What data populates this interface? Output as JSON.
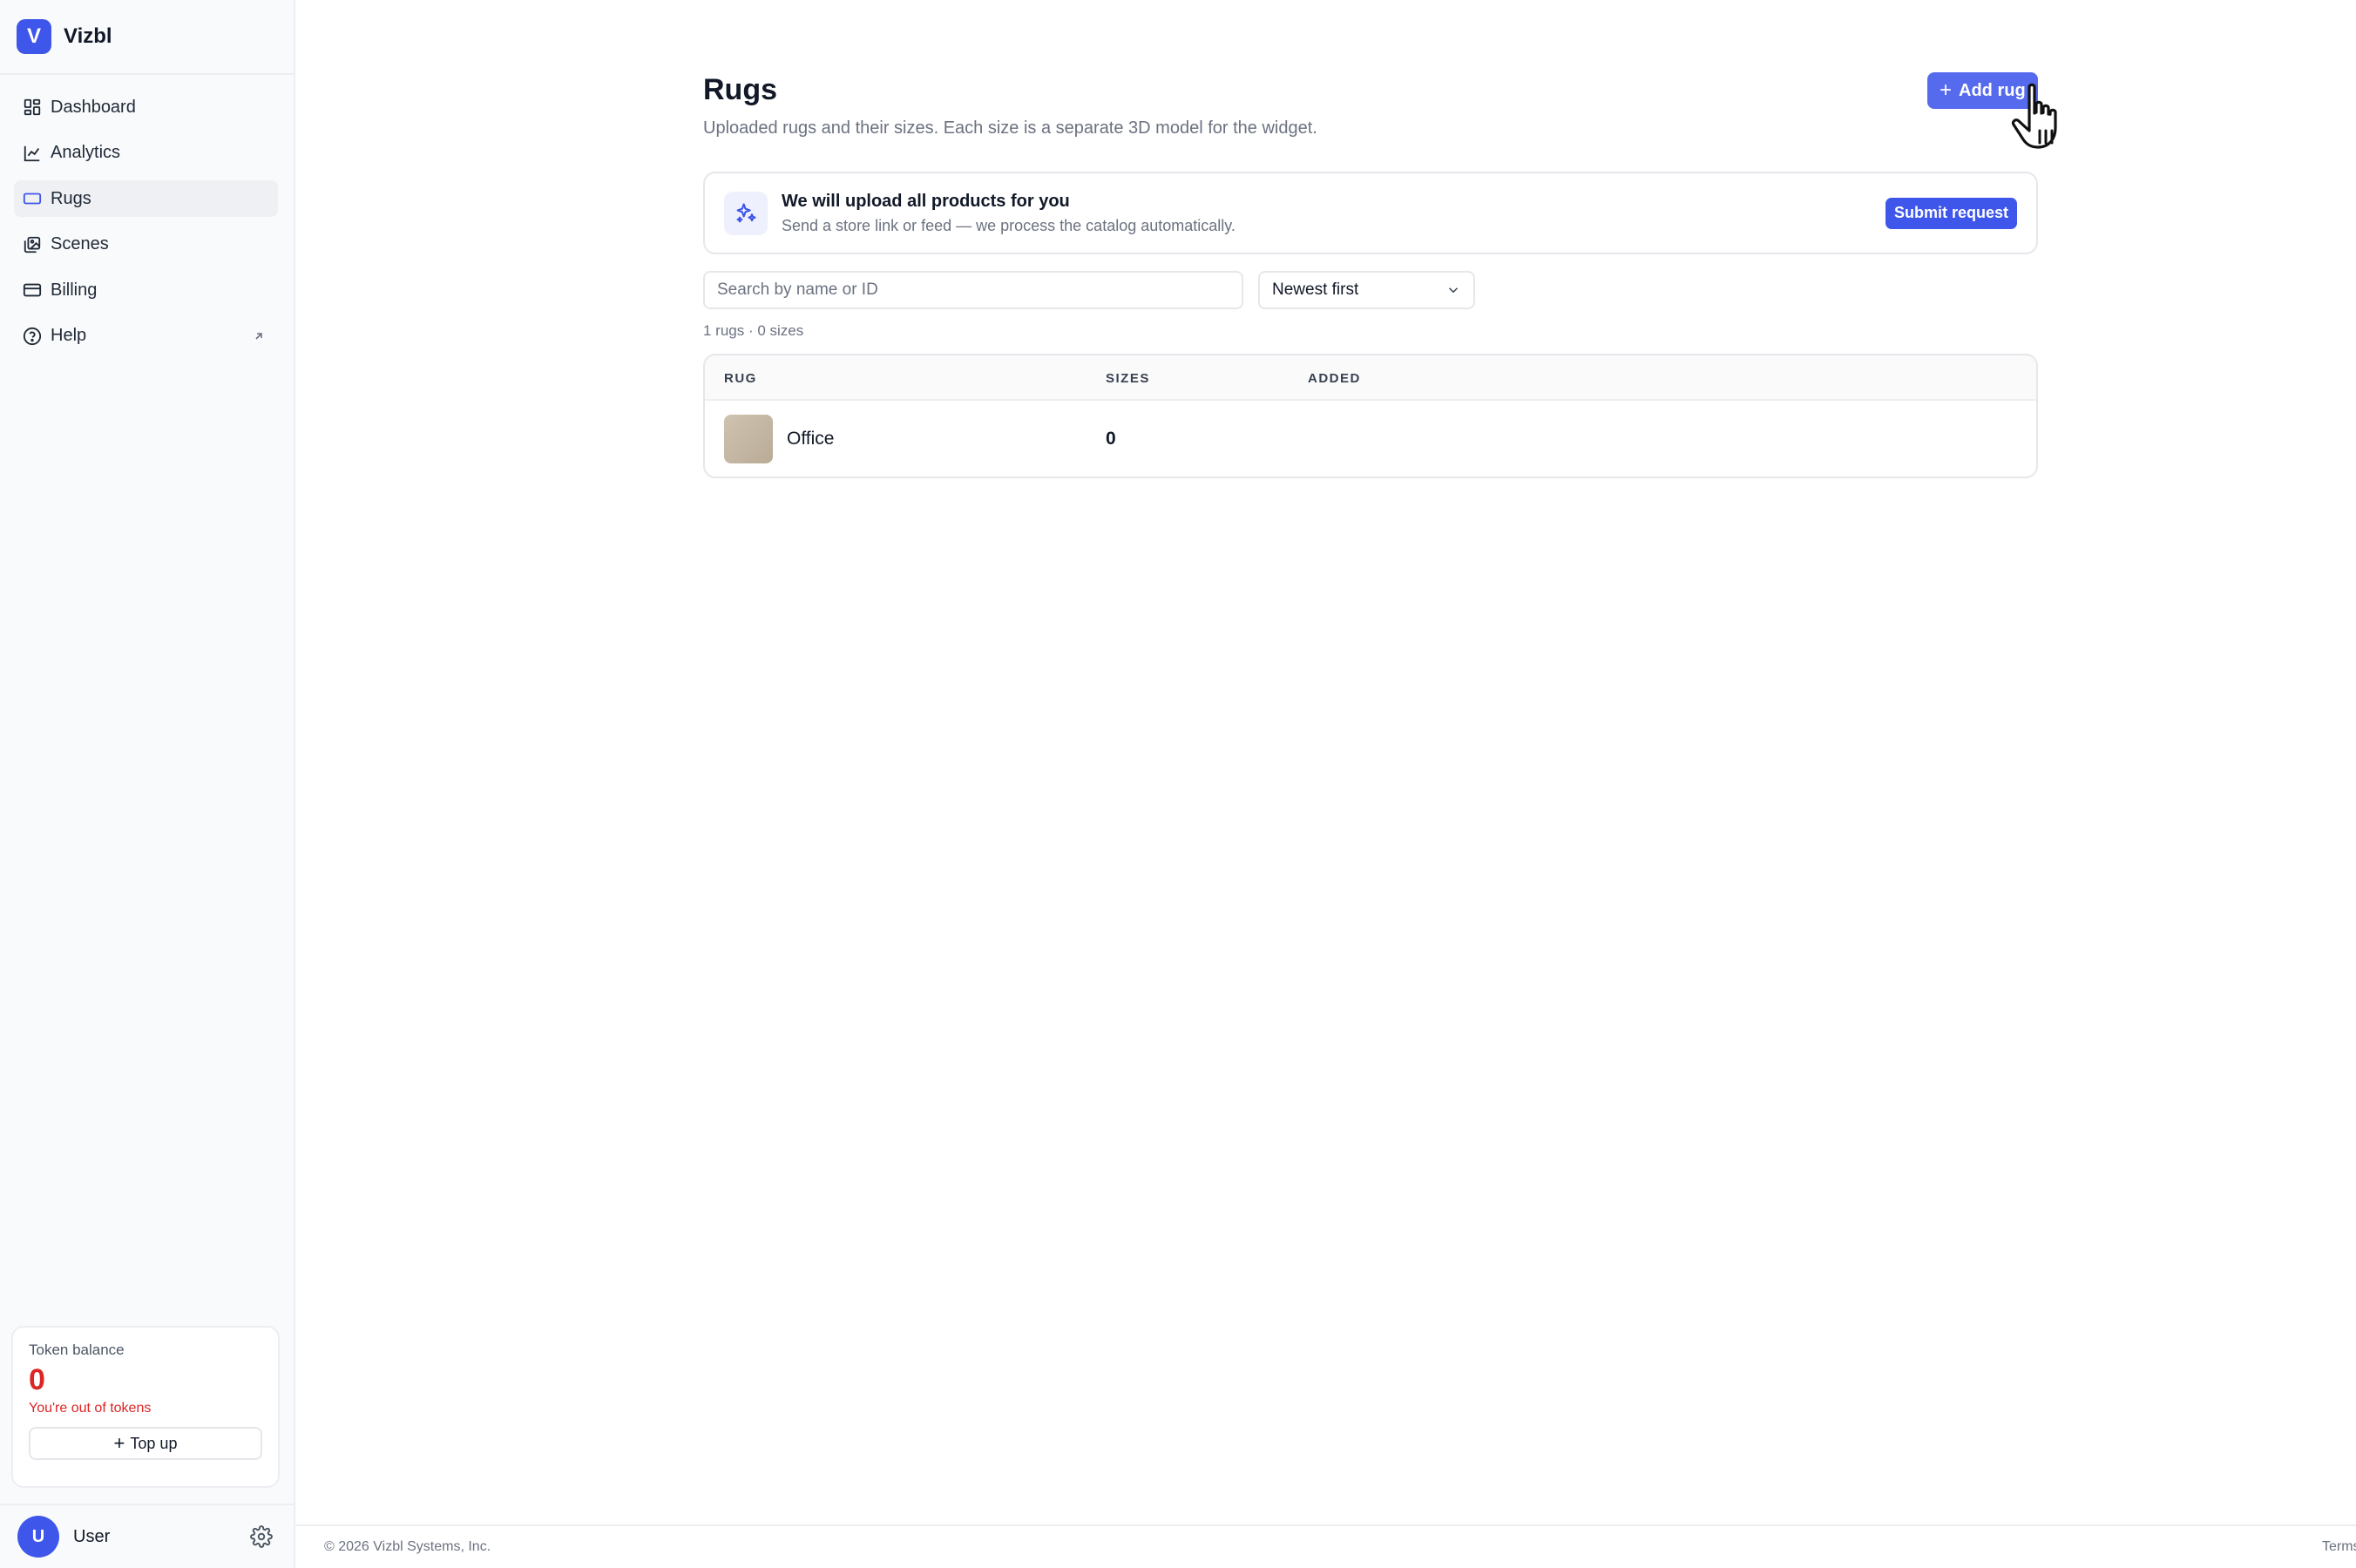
{
  "brand": {
    "logo_letter": "V",
    "name": "Vizbl"
  },
  "sidebar": {
    "items": [
      {
        "label": "Dashboard",
        "icon": "dashboard-icon"
      },
      {
        "label": "Analytics",
        "icon": "chart-line-icon"
      },
      {
        "label": "Rugs",
        "icon": "rug-icon",
        "active": true
      },
      {
        "label": "Scenes",
        "icon": "images-icon"
      },
      {
        "label": "Billing",
        "icon": "credit-card-icon"
      },
      {
        "label": "Help",
        "icon": "help-circle-icon",
        "external": true
      }
    ]
  },
  "token": {
    "label": "Token balance",
    "value": "0",
    "warning": "You're out of tokens",
    "topup_label": "Top up"
  },
  "user": {
    "initial": "U",
    "name": "User"
  },
  "page": {
    "title": "Rugs",
    "subtitle": "Uploaded rugs and their sizes. Each size is a separate 3D model for the widget.",
    "add_button": "Add rug"
  },
  "promo": {
    "title": "We will upload all products for you",
    "description": "Send a store link or feed — we process the catalog automatically.",
    "button": "Submit request"
  },
  "filters": {
    "search_placeholder": "Search by name or ID",
    "sort_selected": "Newest first"
  },
  "counts": "1 rugs · 0 sizes",
  "table": {
    "columns": [
      "RUG",
      "SIZES",
      "ADDED"
    ],
    "rows": [
      {
        "name": "Office",
        "sizes": "0",
        "added": ""
      }
    ]
  },
  "footer": {
    "copyright": "© 2026 Vizbl Systems, Inc.",
    "terms": "Terms"
  },
  "colors": {
    "accent": "#3e56ea",
    "danger": "#dc2626"
  }
}
